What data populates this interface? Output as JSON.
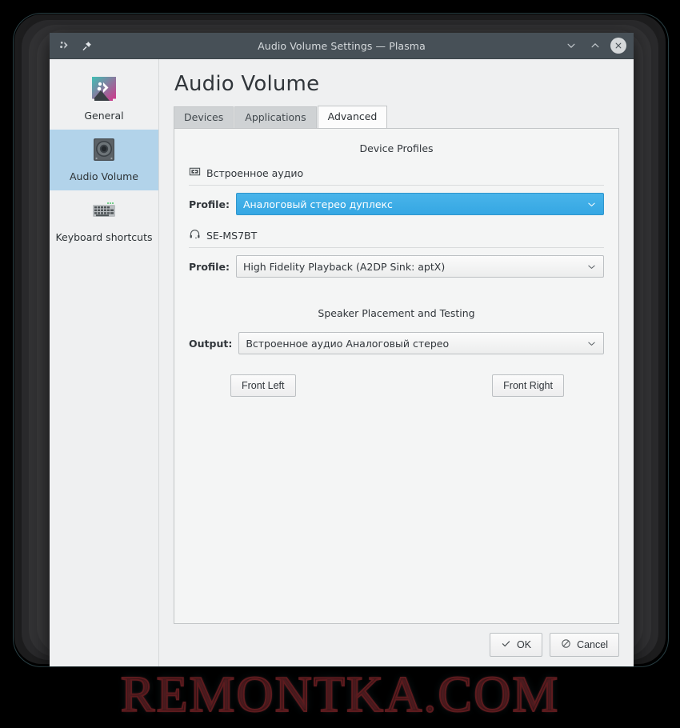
{
  "window": {
    "title": "Audio Volume Settings — Plasma",
    "app_icon": "plasma-icon",
    "pin_button": "pin-icon",
    "minimize_button": "chevron-down-icon",
    "maximize_button": "chevron-up-icon",
    "close_button": "close-icon"
  },
  "sidebar": {
    "items": [
      {
        "label": "General",
        "icon": "plasma-general-icon",
        "selected": false
      },
      {
        "label": "Audio Volume",
        "icon": "speaker-icon",
        "selected": true
      },
      {
        "label": "Keyboard shortcuts",
        "icon": "keyboard-icon",
        "selected": false
      }
    ]
  },
  "page": {
    "title": "Audio Volume"
  },
  "tabs": [
    {
      "label": "Devices",
      "active": false
    },
    {
      "label": "Applications",
      "active": false
    },
    {
      "label": "Advanced",
      "active": true
    }
  ],
  "advanced": {
    "device_profiles_heading": "Device Profiles",
    "devices": [
      {
        "name": "Встроенное аудио",
        "icon": "audio-card-icon",
        "profile_label": "Profile:",
        "profile_value": "Аналоговый стерео дуплекс",
        "highlighted": true
      },
      {
        "name": "SE-MS7BT",
        "icon": "headphones-icon",
        "profile_label": "Profile:",
        "profile_value": "High Fidelity Playback (A2DP Sink: aptX)",
        "highlighted": false
      }
    ],
    "speaker_heading": "Speaker Placement and Testing",
    "output_label": "Output:",
    "output_value": "Встроенное аудио Аналоговый стерео",
    "speaker_buttons": [
      {
        "label": "Front Left"
      },
      {
        "label": "Front Right"
      }
    ]
  },
  "footer": {
    "ok_label": "OK",
    "ok_icon": "check-icon",
    "cancel_label": "Cancel",
    "cancel_icon": "cancel-icon"
  },
  "watermark": {
    "text": "REMONTKA.COM"
  },
  "colors": {
    "titlebar": "#475057",
    "highlight_blue": "#3daee9",
    "selection_blue": "#b2d3ea",
    "window_bg": "#eff0f1",
    "panel_bg": "#f4f5f5",
    "text": "#31363b",
    "watermark_red": "#5d1b1e"
  }
}
